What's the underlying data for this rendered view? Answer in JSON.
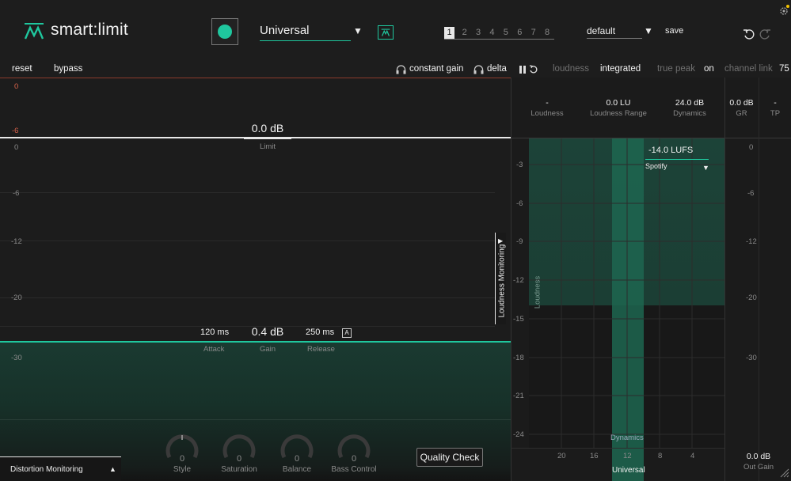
{
  "app": {
    "name": "smart:limit",
    "accent": "#1fc79e"
  },
  "header": {
    "profile": "Universal",
    "slots": [
      "1",
      "2",
      "3",
      "4",
      "5",
      "6",
      "7",
      "8"
    ],
    "preset": "default",
    "save": "save"
  },
  "toolbar": {
    "reset": "reset",
    "bypass": "bypass",
    "constant_gain": "constant gain",
    "delta": "delta",
    "loudness": "loudness",
    "integrated": "integrated",
    "true_peak": "true peak",
    "true_peak_value": "on",
    "channel_link": "channel link",
    "channel_link_value": "75"
  },
  "limiter": {
    "scale_top": [
      "0",
      "-6"
    ],
    "scale": [
      "0",
      "-6",
      "-12",
      "-20",
      "-30"
    ],
    "limit_value": "0.0 dB",
    "limit_label": "Limit",
    "attack_value": "120 ms",
    "attack_label": "Attack",
    "gain_value": "0.4 dB",
    "gain_label": "Gain",
    "release_value": "250 ms",
    "release_label": "Release",
    "release_auto": "A",
    "loudness_monitoring": "Loudness Monitoring",
    "distortion_monitoring": "Distortion Monitoring",
    "quality_check": "Quality Check"
  },
  "knobs": [
    {
      "label": "Style",
      "value": "0"
    },
    {
      "label": "Saturation",
      "value": "0"
    },
    {
      "label": "Balance",
      "value": "0"
    },
    {
      "label": "Bass Control",
      "value": "0"
    }
  ],
  "stats": {
    "loudness": {
      "value": "-",
      "label": "Loudness"
    },
    "range": {
      "value": "0.0 LU",
      "label": "Loudness Range"
    },
    "dynamics": {
      "value": "24.0 dB",
      "label": "Dynamics"
    },
    "gr": {
      "value": "0.0 dB",
      "label": "GR"
    },
    "tp": {
      "value": "-",
      "label": "TP"
    }
  },
  "loudness_plot": {
    "y_ticks": [
      "-3",
      "-6",
      "-9",
      "-12",
      "-15",
      "-18",
      "-21",
      "-24"
    ],
    "x_ticks": [
      "20",
      "16",
      "12",
      "8",
      "4"
    ],
    "y_label": "Loudness",
    "x_label": "Dynamics",
    "target_value": "-14.0 LUFS",
    "target_platform": "Spotify",
    "profile_label": "Universal"
  },
  "meters": {
    "gr_scale": [
      "0",
      "-6",
      "-12",
      "-20",
      "-30"
    ],
    "out_gain_value": "0.0 dB",
    "out_gain_label": "Out Gain"
  }
}
